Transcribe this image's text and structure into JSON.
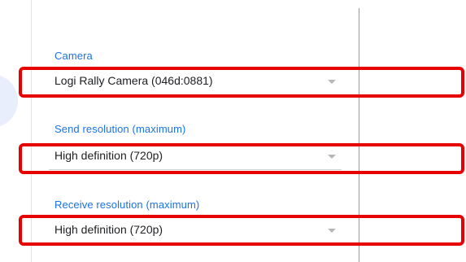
{
  "settings": {
    "camera": {
      "label": "Camera",
      "value": "Logi Rally Camera (046d:0881)",
      "caret_icon": "dropdown-arrow-icon"
    },
    "send_resolution": {
      "label": "Send resolution (maximum)",
      "value": "High definition (720p)",
      "caret_icon": "dropdown-arrow-icon"
    },
    "receive_resolution": {
      "label": "Receive resolution (maximum)",
      "value": "High definition (720p)",
      "caret_icon": "dropdown-arrow-icon"
    }
  },
  "colors": {
    "label_blue": "#1a73e8",
    "highlight_red": "#e60000",
    "value_text": "#202124"
  }
}
